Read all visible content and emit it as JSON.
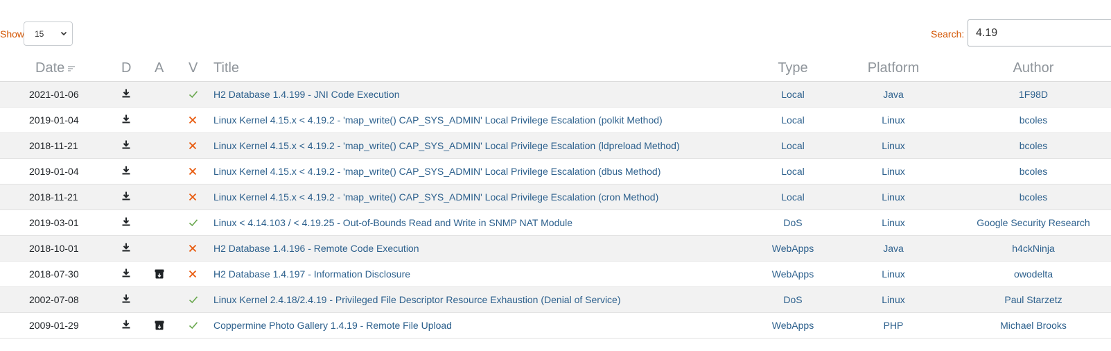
{
  "controls": {
    "show_label": "Show",
    "show_value": "15",
    "search_label": "Search:",
    "search_value": "4.19"
  },
  "columns": {
    "date": "Date",
    "d": "D",
    "a": "A",
    "v": "V",
    "title": "Title",
    "type": "Type",
    "platform": "Platform",
    "author": "Author"
  },
  "colors": {
    "accent_orange": "#d35400",
    "link_blue": "#2b5f8c",
    "verified_green": "#6aa84f",
    "unverified_orange": "#e8590c"
  },
  "rows": [
    {
      "date": "2021-01-06",
      "app": false,
      "verified": true,
      "title": "H2 Database 1.4.199 - JNI Code Execution",
      "type": "Local",
      "platform": "Java",
      "author": "1F98D"
    },
    {
      "date": "2019-01-04",
      "app": false,
      "verified": false,
      "title": "Linux Kernel 4.15.x < 4.19.2 - 'map_write() CAP_SYS_ADMIN' Local Privilege Escalation (polkit Method)",
      "type": "Local",
      "platform": "Linux",
      "author": "bcoles"
    },
    {
      "date": "2018-11-21",
      "app": false,
      "verified": false,
      "title": "Linux Kernel 4.15.x < 4.19.2 - 'map_write() CAP_SYS_ADMIN' Local Privilege Escalation (ldpreload Method)",
      "type": "Local",
      "platform": "Linux",
      "author": "bcoles"
    },
    {
      "date": "2019-01-04",
      "app": false,
      "verified": false,
      "title": "Linux Kernel 4.15.x < 4.19.2 - 'map_write() CAP_SYS_ADMIN' Local Privilege Escalation (dbus Method)",
      "type": "Local",
      "platform": "Linux",
      "author": "bcoles"
    },
    {
      "date": "2018-11-21",
      "app": false,
      "verified": false,
      "title": "Linux Kernel 4.15.x < 4.19.2 - 'map_write() CAP_SYS_ADMIN' Local Privilege Escalation (cron Method)",
      "type": "Local",
      "platform": "Linux",
      "author": "bcoles"
    },
    {
      "date": "2019-03-01",
      "app": false,
      "verified": true,
      "title": "Linux < 4.14.103 / < 4.19.25 - Out-of-Bounds Read and Write in SNMP NAT Module",
      "type": "DoS",
      "platform": "Linux",
      "author": "Google Security Research"
    },
    {
      "date": "2018-10-01",
      "app": false,
      "verified": false,
      "title": "H2 Database 1.4.196 - Remote Code Execution",
      "type": "WebApps",
      "platform": "Java",
      "author": "h4ckNinja"
    },
    {
      "date": "2018-07-30",
      "app": true,
      "verified": false,
      "title": "H2 Database 1.4.197 - Information Disclosure",
      "type": "WebApps",
      "platform": "Linux",
      "author": "owodelta"
    },
    {
      "date": "2002-07-08",
      "app": false,
      "verified": true,
      "title": "Linux Kernel 2.4.18/2.4.19 - Privileged File Descriptor Resource Exhaustion (Denial of Service)",
      "type": "DoS",
      "platform": "Linux",
      "author": "Paul Starzetz"
    },
    {
      "date": "2009-01-29",
      "app": true,
      "verified": true,
      "title": "Coppermine Photo Gallery 1.4.19 - Remote File Upload",
      "type": "WebApps",
      "platform": "PHP",
      "author": "Michael Brooks"
    }
  ]
}
